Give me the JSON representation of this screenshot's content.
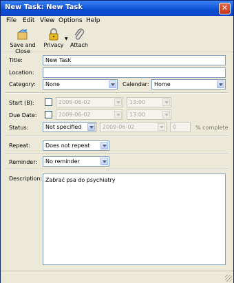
{
  "window": {
    "title": "New Task: New Task"
  },
  "menu": {
    "items": [
      "File",
      "Edit",
      "View",
      "Options",
      "Help"
    ]
  },
  "toolbar": {
    "save_close": "Save and Close",
    "privacy": "Privacy",
    "attach": "Attach"
  },
  "form": {
    "title_label": "Title:",
    "title_value": "New Task",
    "location_label": "Location:",
    "location_value": "",
    "category_label": "Category:",
    "category_value": "None",
    "calendar_label": "Calendar:",
    "calendar_value": "Home",
    "start_label": "Start (B):",
    "start_date": "2009-06-02",
    "start_time": "13:00",
    "due_label": "Due Date:",
    "due_date": "2009-06-02",
    "due_time": "13:00",
    "status_label": "Status:",
    "status_value": "Not specified",
    "status_date": "2009-06-02",
    "percent_value": "0",
    "percent_label": "% complete",
    "repeat_label": "Repeat:",
    "repeat_value": "Does not repeat",
    "reminder_label": "Reminder:",
    "reminder_value": "No reminder",
    "description_label": "Description:",
    "description_value": "Zabrać psa do psychiatry"
  }
}
